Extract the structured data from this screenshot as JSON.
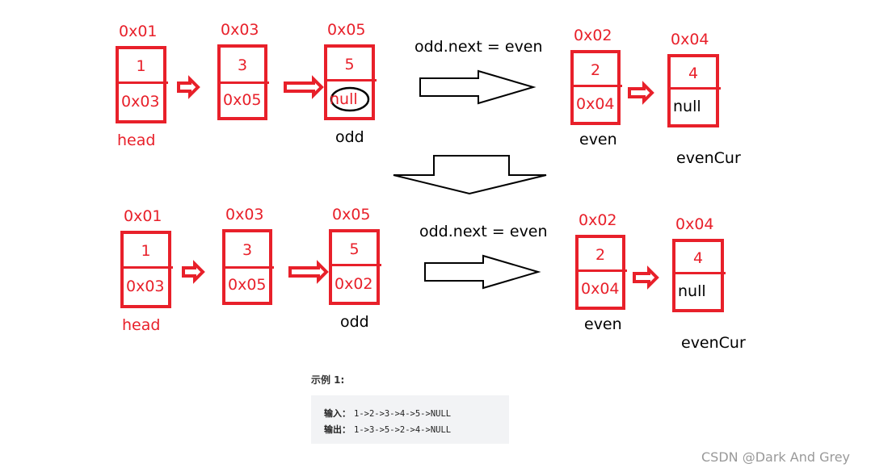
{
  "diagrams": [
    {
      "caption": "odd.next = even",
      "odd_nodes": [
        {
          "addr": "0x01",
          "value": "1",
          "next": "0x03",
          "label": "head"
        },
        {
          "addr": "0x03",
          "value": "3",
          "next": "0x05",
          "label": ""
        },
        {
          "addr": "0x05",
          "value": "5",
          "next": "null",
          "label": "odd",
          "next_circled": true
        }
      ],
      "even_nodes": [
        {
          "addr": "0x02",
          "value": "2",
          "next": "0x04",
          "label": "even"
        },
        {
          "addr": "0x04",
          "value": "4",
          "next": "null",
          "label": "evenCur"
        }
      ]
    },
    {
      "caption": "odd.next = even",
      "odd_nodes": [
        {
          "addr": "0x01",
          "value": "1",
          "next": "0x03",
          "label": "head"
        },
        {
          "addr": "0x03",
          "value": "3",
          "next": "0x05",
          "label": ""
        },
        {
          "addr": "0x05",
          "value": "5",
          "next": "0x02",
          "label": "odd",
          "next_circled": false
        }
      ],
      "even_nodes": [
        {
          "addr": "0x02",
          "value": "2",
          "next": "0x04",
          "label": "even"
        },
        {
          "addr": "0x04",
          "value": "4",
          "next": "null",
          "label": "evenCur"
        }
      ]
    }
  ],
  "example": {
    "title": "示例 1:",
    "input_label": "输入：",
    "input": "1->2->3->4->5->NULL",
    "output_label": "输出：",
    "output": "1->3->5->2->4->NULL"
  },
  "watermark": "CSDN @Dark And Grey",
  "colors": {
    "node": "#e8202a",
    "arrow": "#000000",
    "example_bg": "#f2f3f5"
  }
}
